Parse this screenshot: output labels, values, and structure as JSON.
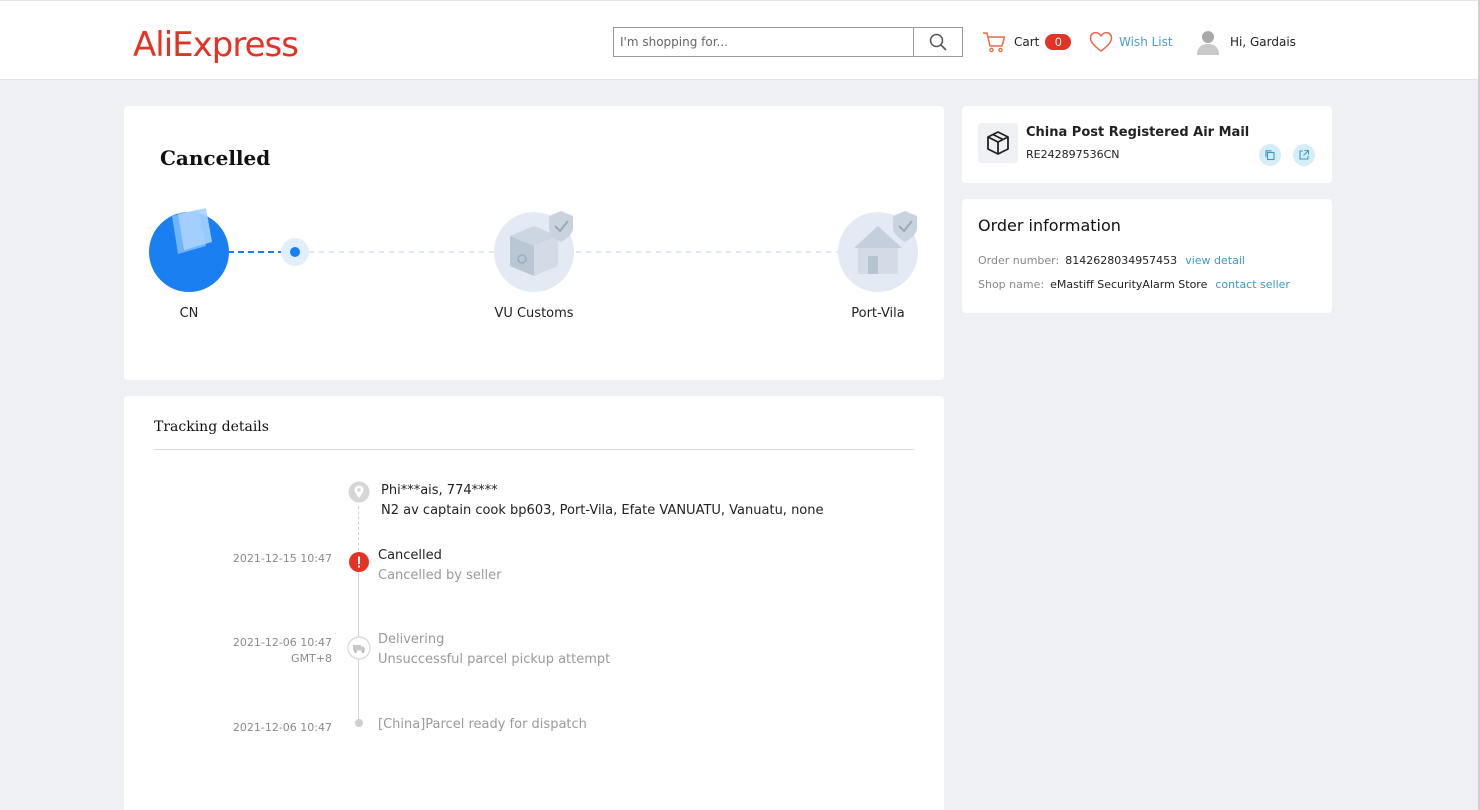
{
  "header": {
    "logo": "AliExpress",
    "search": {
      "placeholder": "I'm shopping for..."
    },
    "cart": {
      "label": "Cart",
      "count": "0"
    },
    "wishlist": {
      "label": "Wish List"
    },
    "user": {
      "greeting": "Hi, Gardais"
    }
  },
  "status": {
    "title": "Cancelled",
    "nodes": [
      {
        "label": "CN",
        "icon": "shopping-bag-icon",
        "state": "active"
      },
      {
        "label": "VU Customs",
        "icon": "customs-package-icon",
        "state": "pending"
      },
      {
        "label": "Port-Vila",
        "icon": "house-icon",
        "state": "pending"
      }
    ]
  },
  "tracking": {
    "title": "Tracking details",
    "address": {
      "name": "Phi***ais,  774****",
      "line": "N2 av captain cook bp603,  Port-Vila,  Efate VANUATU,  Vanuatu,  none"
    },
    "events": [
      {
        "time": "2021-12-15 10:47",
        "tz": "",
        "title": "Cancelled",
        "detail": "Cancelled by seller",
        "icon": "alert-icon"
      },
      {
        "time": "2021-12-06 10:47",
        "tz": "GMT+8",
        "title": "Delivering",
        "detail": "Unsuccessful parcel pickup attempt",
        "icon": "truck-icon"
      },
      {
        "time": "2021-12-06 10:47",
        "tz": "",
        "title": "[China]Parcel ready for dispatch",
        "detail": "",
        "icon": "dot-icon"
      }
    ]
  },
  "shipping": {
    "carrier": "China Post Registered Air Mail",
    "tracking_number": "RE242897536CN"
  },
  "order": {
    "title": "Order information",
    "number_label": "Order number:",
    "number": "8142628034957453",
    "view_detail": "view detail",
    "shop_label": "Shop name:",
    "shop": "eMastiff SecurityAlarm Store",
    "contact": "contact seller"
  },
  "colors": {
    "brand": "#e43225",
    "link": "#3a9ac8",
    "active_blue": "#1a7ff0",
    "page_bg": "#eef0f3"
  }
}
